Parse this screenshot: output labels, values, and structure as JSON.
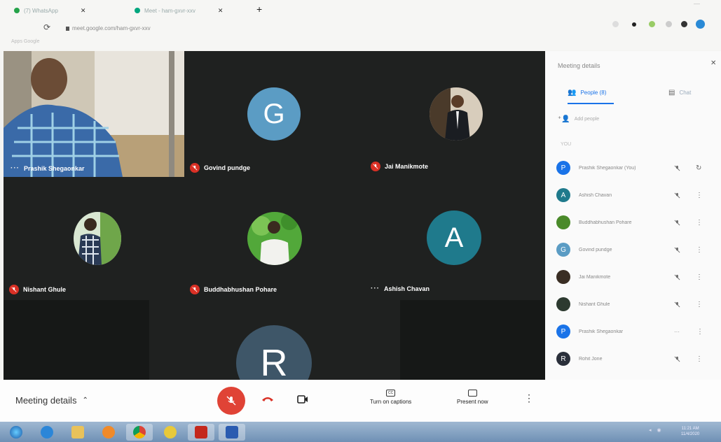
{
  "browser": {
    "tabs": [
      {
        "label": "(7) WhatsApp",
        "color": "#25a34a"
      },
      {
        "label": "Meet - ham-gxvr-xxv",
        "color": "#00a67e"
      }
    ],
    "new_tab": "+",
    "url": "meet.google.com/ham-gxvr-xxv",
    "bookmarks": "Apps   Google"
  },
  "tiles": [
    {
      "name": "Prashik Shegaonkar",
      "kind": "self"
    },
    {
      "name": "Govind pundge",
      "initial": "G",
      "color": "#5b9cc4",
      "muted": true
    },
    {
      "name": "Jai Manikmote",
      "muted": true,
      "photo": "formal"
    },
    {
      "name": "Nishant Ghule",
      "muted": true,
      "photo": "outdoor"
    },
    {
      "name": "Buddhabhushan Pohare",
      "muted": true,
      "photo": "green"
    },
    {
      "name": "Ashish Chavan",
      "initial": "A",
      "color": "#1f7a8c",
      "muted": false
    },
    {
      "name": "",
      "initial": "R",
      "color": "#3e5668"
    }
  ],
  "panel": {
    "title": "Meeting details",
    "tab_people": "People (8)",
    "tab_chat": "Chat",
    "add_people": "Add people",
    "count_label": "YOU",
    "people": [
      {
        "name": "Prashik Shegaonkar (You)",
        "initial": "P",
        "color": "#1a73e8",
        "end": "refresh"
      },
      {
        "name": "Ashish Chavan",
        "initial": "A",
        "color": "#1f7a8c",
        "end": "dots"
      },
      {
        "name": "Buddhabhushan Pohare",
        "initial": "",
        "color": "#4a8a2a",
        "end": "dots"
      },
      {
        "name": "Govind pundge",
        "initial": "G",
        "color": "#5b9cc4",
        "end": "dots"
      },
      {
        "name": "Jai Manikmote",
        "initial": "",
        "color": "#3a2e24",
        "end": "dots"
      },
      {
        "name": "Nishant Ghule",
        "initial": "",
        "color": "#2d3a30",
        "end": "dots"
      },
      {
        "name": "Prashik Shegaonkar",
        "initial": "P",
        "color": "#1a73e8",
        "end": "dots"
      },
      {
        "name": "Rohit Jone",
        "initial": "R",
        "color": "#2a2f3a",
        "end": "dots"
      }
    ]
  },
  "bottom": {
    "meeting_details": "Meeting details",
    "captions": "Turn on captions",
    "cc": "CC",
    "present": "Present now",
    "more": "⋮"
  },
  "tray": {
    "time": "11:21 AM",
    "date": "11/4/2020"
  },
  "colors": {
    "stage": "#1f2120",
    "mic_off": "#d93025",
    "accent": "#1a73e8"
  }
}
